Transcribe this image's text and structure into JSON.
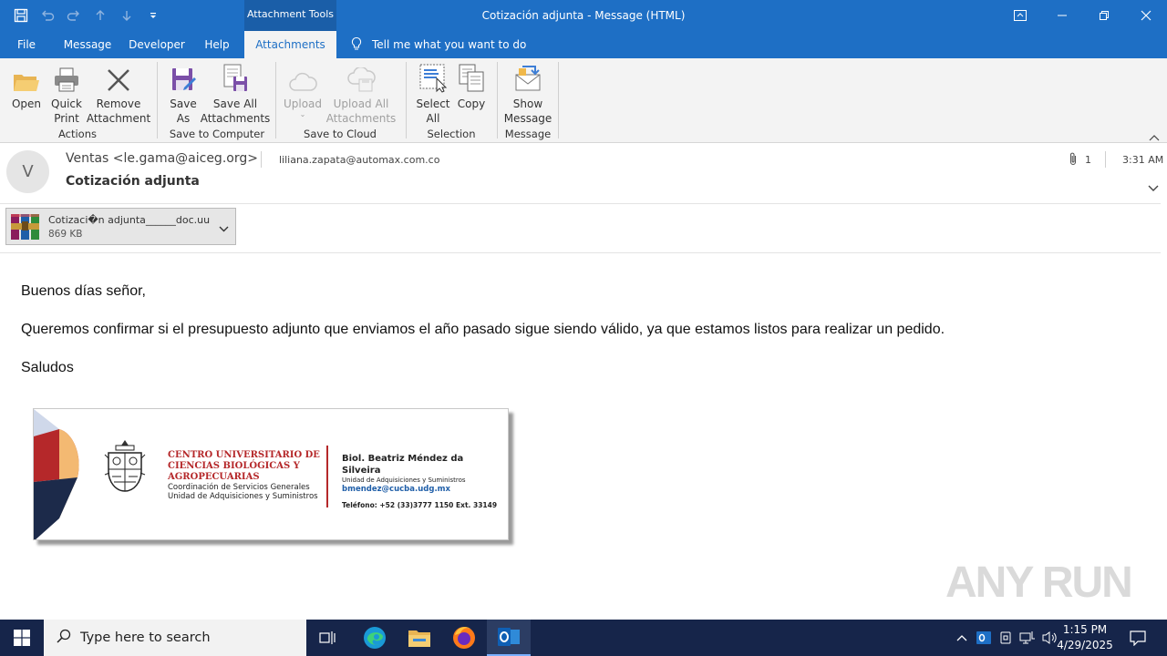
{
  "window": {
    "title": "Cotización adjunta  -  Message (HTML)",
    "context_tab": "Attachment Tools"
  },
  "tabs": [
    {
      "label": "File"
    },
    {
      "label": "Message"
    },
    {
      "label": "Developer"
    },
    {
      "label": "Help"
    },
    {
      "label": "Attachments",
      "active": true
    }
  ],
  "tell_me": "Tell me what you want to do",
  "ribbon": {
    "actions": {
      "group": "Actions",
      "open": "Open",
      "quick_print": [
        "Quick",
        "Print"
      ],
      "remove": [
        "Remove",
        "Attachment"
      ]
    },
    "save_to_computer": {
      "group": "Save to Computer",
      "save_as": [
        "Save",
        "As"
      ],
      "save_all": [
        "Save All",
        "Attachments"
      ]
    },
    "save_to_cloud": {
      "group": "Save to Cloud",
      "upload": "Upload",
      "upload_all": [
        "Upload All",
        "Attachments"
      ]
    },
    "selection": {
      "group": "Selection",
      "select_all": [
        "Select",
        "All"
      ],
      "copy": "Copy"
    },
    "message": {
      "group": "Message",
      "show_message": [
        "Show",
        "Message"
      ]
    }
  },
  "header": {
    "avatar_letter": "V",
    "sender": "Ventas <le.gama@aiceg.org>",
    "recipient": "liliana.zapata@automax.com.co",
    "subject": "Cotización adjunta",
    "attachment_count": "1",
    "time": "3:31 AM"
  },
  "attachment": {
    "name": "Cotizaci�n adjunta______doc.uu",
    "size": "869 KB"
  },
  "body": {
    "greeting": "Buenos días señor,",
    "paragraph": "Queremos confirmar si el presupuesto adjunto que enviamos el año pasado sigue siendo válido, ya que estamos listos para realizar un pedido.",
    "closing": "Saludos"
  },
  "signature": {
    "org_line1": "CENTRO UNIVERSITARIO DE",
    "org_line2": "CIENCIAS BIOLÓGICAS Y",
    "org_line3": "AGROPECUARIAS",
    "coord_line1": "Coordinación de Servicios Generales",
    "coord_line2": "Unidad de Adquisiciones y Suministros",
    "name_line1": "Biol. Beatriz Méndez da",
    "name_line2": "Silveira",
    "unit": "Unidad de Adquisiciones y Suministros",
    "email": "bmendez@cucba.udg.mx",
    "phone": "Teléfono: +52 (33)3777 1150 Ext. 33149"
  },
  "watermark": "ANY RUN",
  "taskbar": {
    "search_placeholder": "Type here to search",
    "clock_time": "1:15 PM",
    "clock_date": "4/29/2025"
  },
  "colors": {
    "accent": "#1e6fc5",
    "taskbar": "#16254a",
    "signature_red": "#b5282a"
  }
}
